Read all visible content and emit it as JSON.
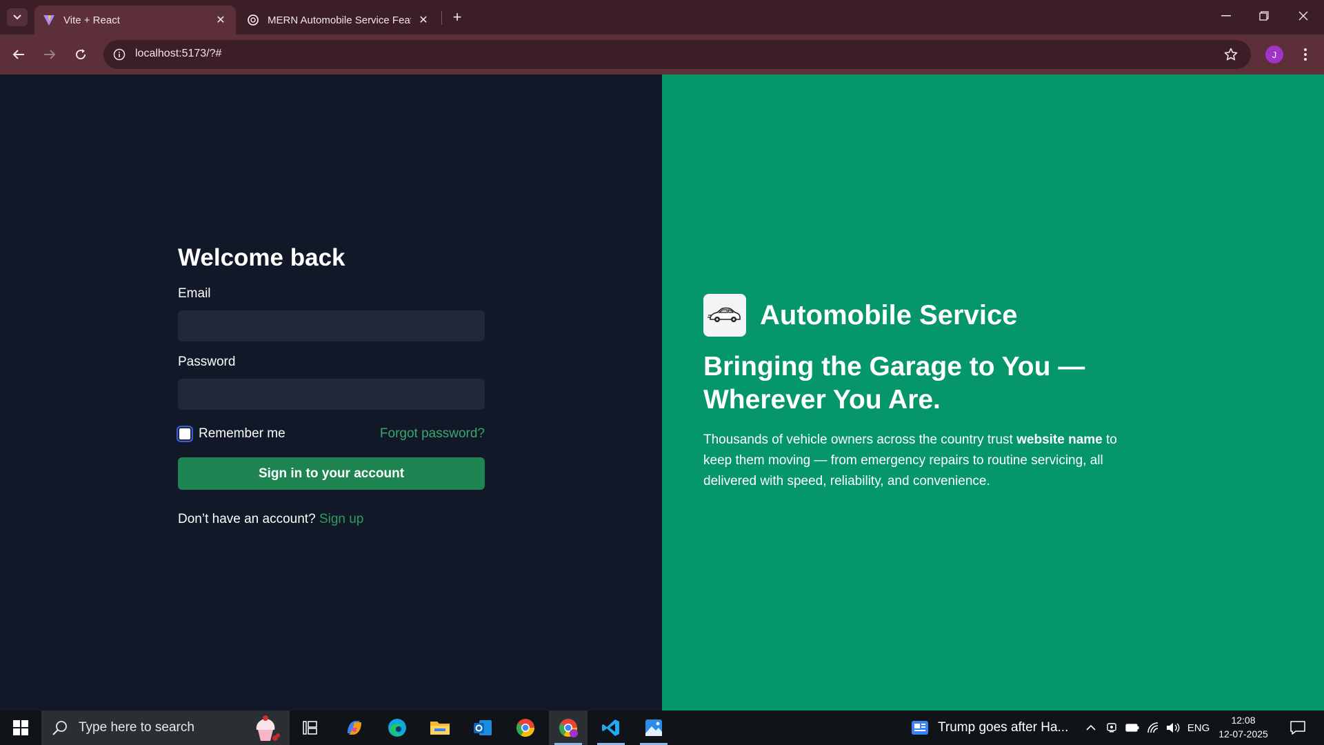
{
  "browser": {
    "tabs": [
      {
        "title": "Vite + React",
        "active": true,
        "favicon": "vite-icon"
      },
      {
        "title": "MERN Automobile Service Feat",
        "active": false,
        "favicon": "openai-icon"
      }
    ],
    "url": "localhost:5173/?#",
    "profile_initial": "J"
  },
  "login": {
    "title": "Welcome back",
    "email_label": "Email",
    "email_value": "",
    "password_label": "Password",
    "password_value": "",
    "remember_label": "Remember me",
    "remember_checked": false,
    "forgot_label": "Forgot password?",
    "submit_label": "Sign in to your account",
    "no_account_text": "Don’t have an account?",
    "signup_label": "Sign up"
  },
  "hero": {
    "brand_name": "Automobile Service",
    "logo_icon": "car-icon",
    "headline_line1": "Bringing the Garage to You —",
    "headline_line2": "Wherever You Are.",
    "blurb_start": "Thousands of vehicle owners across the country trust",
    "blurb_bold": "website name",
    "blurb_end": "to keep them moving — from emergency repairs to routine servicing, all delivered with speed, reliability, and convenience."
  },
  "taskbar": {
    "search_placeholder": "Type here to search",
    "news_text": "Trump goes after Ha...",
    "language": "ENG",
    "time": "12:08",
    "date": "12-07-2025"
  },
  "colors": {
    "left_bg": "#111827",
    "right_bg": "#059669",
    "button_bg": "#1e8552",
    "link": "#2e8b57"
  }
}
